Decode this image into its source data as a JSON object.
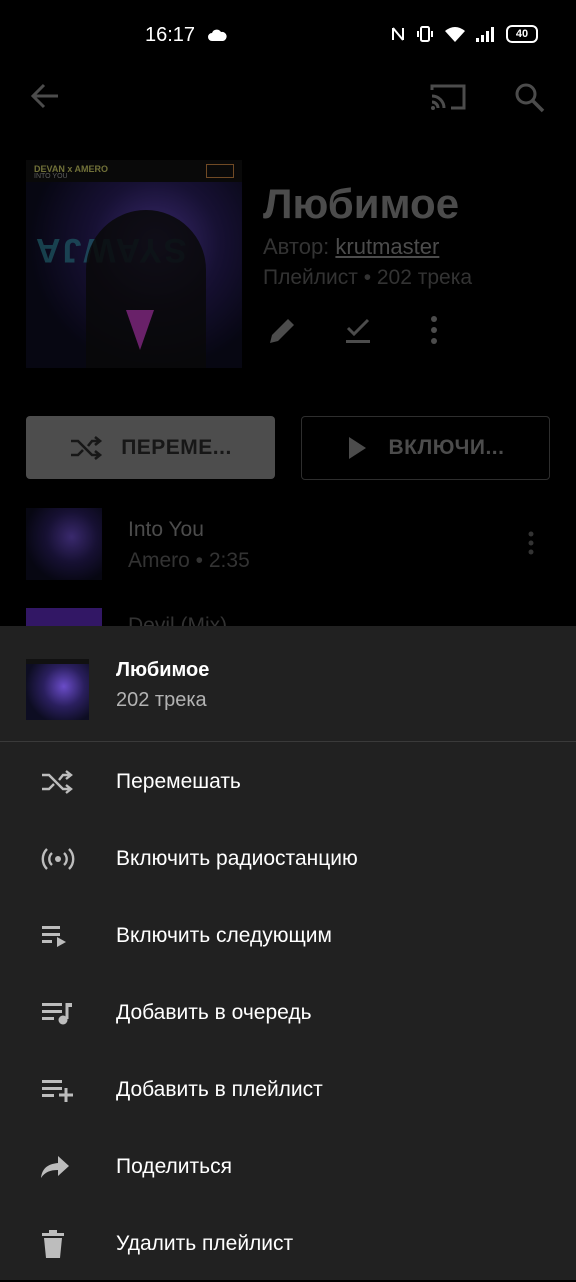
{
  "status_bar": {
    "time": "16:17",
    "battery": "40"
  },
  "header": {
    "back_icon": "arrow-back-icon",
    "cast_icon": "cast-icon",
    "search_icon": "search-icon"
  },
  "playlist": {
    "cover_text_artists": "DEVAN x AMERO",
    "cover_text_title": "INTO YOU",
    "title": "Любимое",
    "author_prefix": "Автор: ",
    "author_name": "krutmaster",
    "meta": "Плейлист • 202 трека"
  },
  "actions": {
    "shuffle_label": "ПЕРЕМЕ...",
    "play_label": "ВКЛЮЧИ..."
  },
  "tracks": [
    {
      "title": "Into You",
      "subtitle": "Amero • 2:35"
    },
    {
      "title": "Devil (Mix)"
    }
  ],
  "sheet": {
    "title": "Любимое",
    "subtitle": "202 трека",
    "items": [
      {
        "icon": "shuffle-icon",
        "label": "Перемешать"
      },
      {
        "icon": "radio-icon",
        "label": "Включить радиостанцию"
      },
      {
        "icon": "play-next-icon",
        "label": "Включить следующим"
      },
      {
        "icon": "queue-music-icon",
        "label": "Добавить в очередь"
      },
      {
        "icon": "playlist-add-icon",
        "label": "Добавить в плейлист"
      },
      {
        "icon": "share-icon",
        "label": "Поделиться"
      },
      {
        "icon": "delete-icon",
        "label": "Удалить плейлист"
      }
    ]
  },
  "colors": {
    "sheet_bg": "#212121",
    "accent_gray": "#8c8c8c"
  }
}
